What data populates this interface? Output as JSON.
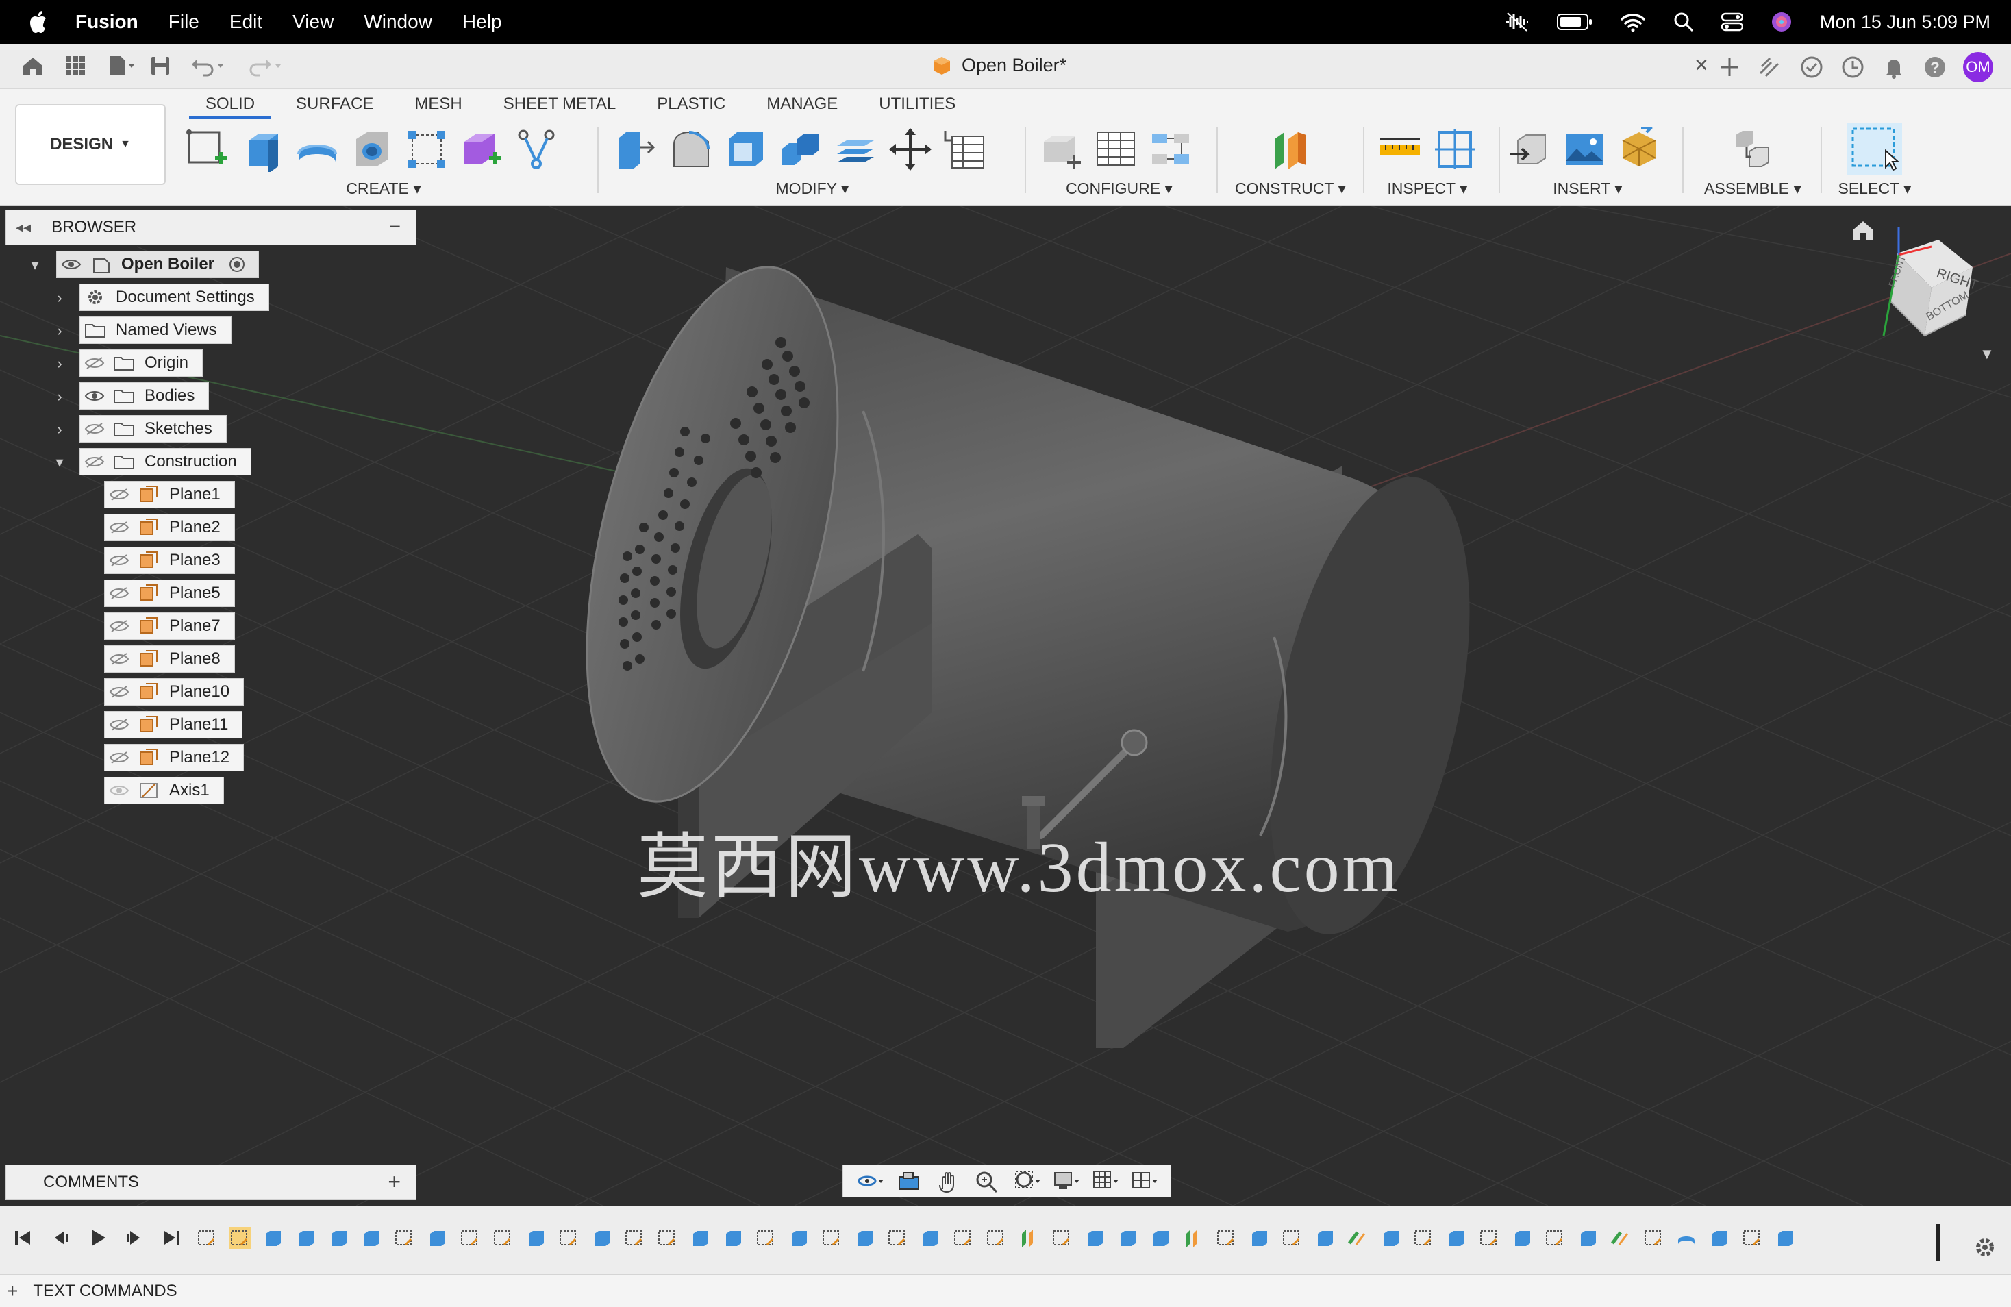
{
  "menubar": {
    "app": "Fusion",
    "items": [
      "File",
      "Edit",
      "View",
      "Window",
      "Help"
    ],
    "datetime": "Mon 15 Jun  5:09 PM"
  },
  "titlebar": {
    "doc_title": "Open Boiler*",
    "avatar_initials": "OM"
  },
  "toolbar": {
    "workspace": "DESIGN",
    "tabs": [
      "SOLID",
      "SURFACE",
      "MESH",
      "SHEET METAL",
      "PLASTIC",
      "MANAGE",
      "UTILITIES"
    ],
    "groups": {
      "create": "CREATE",
      "modify": "MODIFY",
      "configure": "CONFIGURE",
      "construct": "CONSTRUCT",
      "inspect": "INSPECT",
      "insert": "INSERT",
      "assemble": "ASSEMBLE",
      "select": "SELECT"
    }
  },
  "browser": {
    "title": "BROWSER",
    "root": "Open Boiler",
    "nodes": [
      "Document Settings",
      "Named Views",
      "Origin",
      "Bodies",
      "Sketches",
      "Construction"
    ],
    "construction_items": [
      "Plane1",
      "Plane2",
      "Plane3",
      "Plane5",
      "Plane7",
      "Plane8",
      "Plane10",
      "Plane11",
      "Plane12",
      "Axis1"
    ]
  },
  "comments": {
    "title": "COMMENTS"
  },
  "viewcube": {
    "right": "RIGHT",
    "front": "FRONT",
    "bottom": "BOTTOM"
  },
  "watermark": "莫西网www.3dmox.com",
  "textcommands": {
    "title": "TEXT COMMANDS"
  },
  "colors": {
    "accent": "#2b6ed1",
    "viewport": "#2d2d2d",
    "toolbar": "#f3f3f3"
  }
}
